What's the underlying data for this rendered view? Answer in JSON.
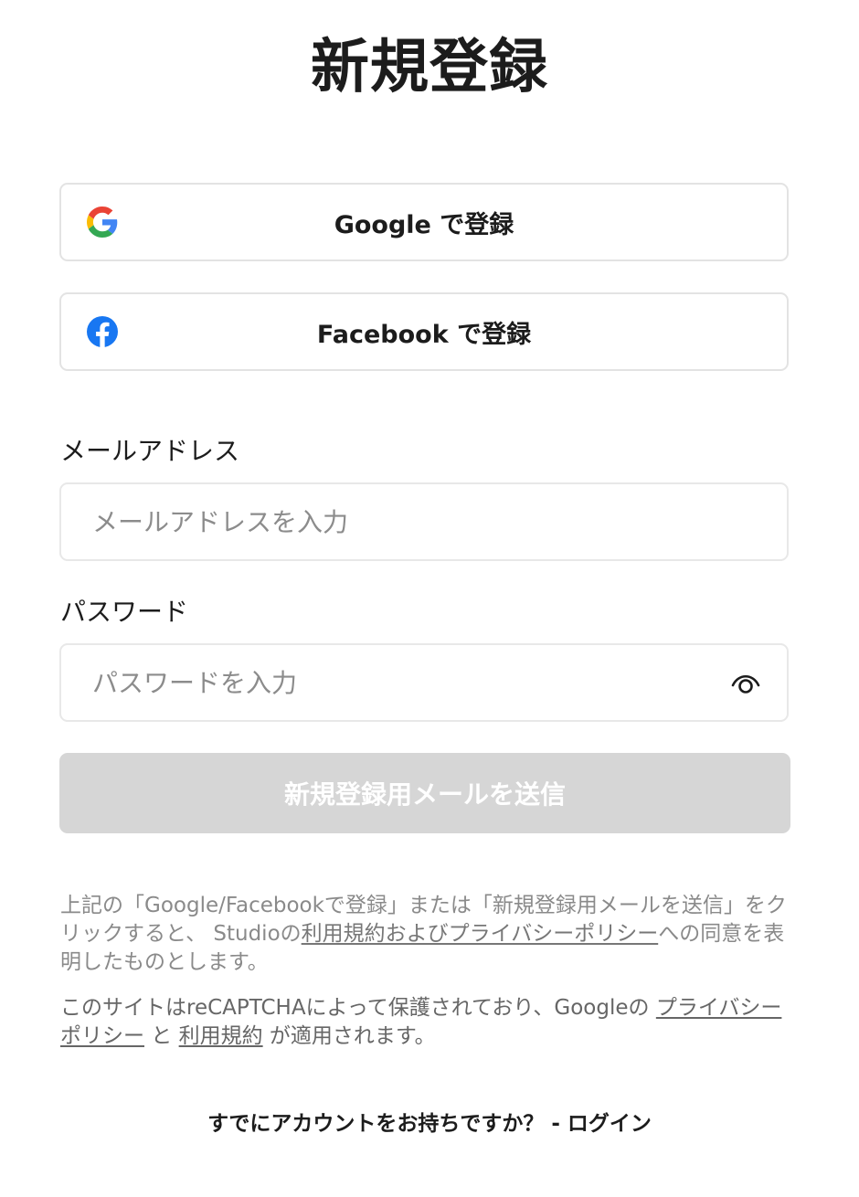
{
  "page": {
    "title": "新規登録"
  },
  "social": {
    "google_label": "Google で登録",
    "facebook_label": "Facebook で登録"
  },
  "form": {
    "email_label": "メールアドレス",
    "email_placeholder": "メールアドレスを入力",
    "email_value": "",
    "password_label": "パスワード",
    "password_placeholder": "パスワードを入力",
    "password_value": "",
    "submit_label": "新規登録用メールを送信"
  },
  "notice": {
    "terms_prefix": "上記の「Google/Facebookで登録」または「新規登録用メールを送信」をクリックすると、 Studioの",
    "terms_link": "利用規約およびプライバシーポリシー",
    "terms_suffix": "への同意を表明したものとします。",
    "recaptcha_prefix": "このサイトはreCAPTCHAによって保護されており、Googleの ",
    "recaptcha_privacy_link": "プライバシーポリシー",
    "recaptcha_and": " と ",
    "recaptcha_terms_link": "利用規約",
    "recaptcha_suffix": " が適用されます。"
  },
  "footer": {
    "login_prompt": "すでにアカウントをお持ちですか？ - ログイン"
  },
  "icons": {
    "google": "google-g-icon",
    "facebook": "facebook-f-icon",
    "eye": "eye-icon"
  },
  "colors": {
    "facebook_blue": "#1877F2",
    "google_blue": "#4285F4",
    "google_red": "#EA4335",
    "google_yellow": "#FBBC05",
    "google_green": "#34A853",
    "submit_disabled_bg": "#D6D6D6",
    "border": "#E3E3E3"
  }
}
